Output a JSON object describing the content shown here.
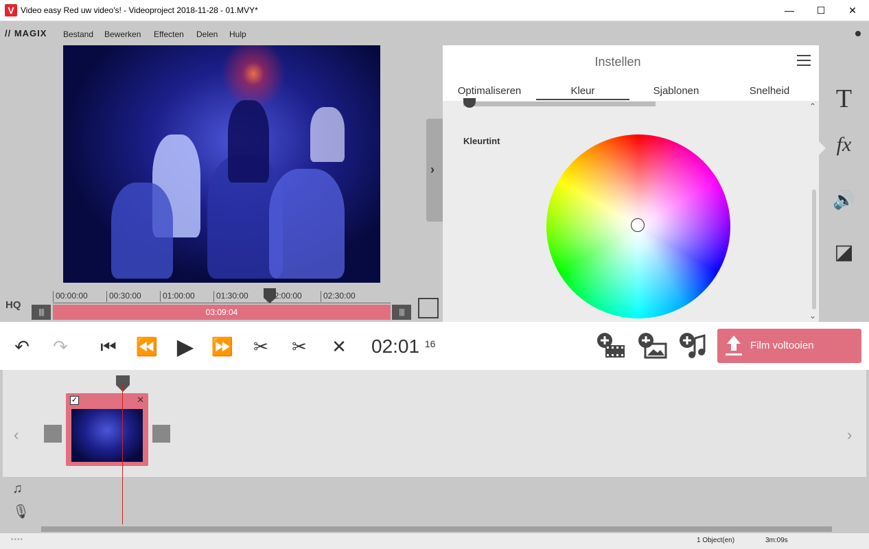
{
  "window": {
    "title": "Video easy Red uw video's! - Videoproject 2018-11-28 - 01.MVY*",
    "app_icon_letter": "V",
    "minimize": "—",
    "maximize": "☐",
    "close": "✕"
  },
  "menubar": {
    "logo": "// MAGIX",
    "items": [
      "Bestand",
      "Bewerken",
      "Effecten",
      "Delen",
      "Hulp"
    ]
  },
  "preview": {
    "ruler_ticks": [
      "00:00:00",
      "00:30:00",
      "01:00:00",
      "01:30:00",
      "02:00:00",
      "02:30:00"
    ],
    "range_duration": "03:09:04",
    "grip_label": "||||",
    "hq_label": "HQ"
  },
  "settings": {
    "title": "Instellen",
    "tabs": [
      "Optimaliseren",
      "Kleur",
      "Sjablonen",
      "Snelheid"
    ],
    "active_tab": "Kleur",
    "section_label": "Kleurtint"
  },
  "tools": {
    "text_icon": "T",
    "fx_icon": "fx",
    "audio_icon": "🔊",
    "contrast_icon": "◪"
  },
  "transport": {
    "timecode": "02:01",
    "timecode_frames": "16",
    "finish_label": "Film voltooien"
  },
  "timeline": {
    "clip_checked": "✓",
    "clip_close": "✕",
    "left_arrow": "‹",
    "right_arrow": "›"
  },
  "status": {
    "dots": "••••",
    "objects": "1 Object(en)",
    "duration": "3m:09s"
  },
  "colors": {
    "accent": "#e07080",
    "panel": "#ececec",
    "chrome": "#c8c8c8"
  }
}
